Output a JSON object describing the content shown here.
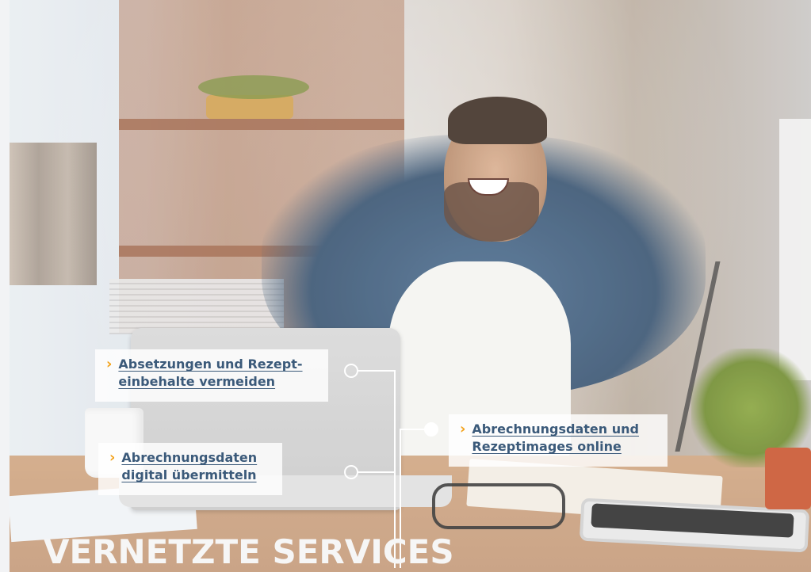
{
  "callouts": [
    {
      "text": "Absetzungen und Rezept-\neinbehalte vermeiden"
    },
    {
      "text": "Abrechnungsdaten und\nRezeptimages online"
    },
    {
      "text": "Abrechnungsdaten\ndigital übermitteln"
    }
  ],
  "title": "VERNETZTE SERVICES",
  "icons": {
    "callout_marker": "chevron-right-icon",
    "connector": "circle-node-icon"
  },
  "colors": {
    "accent": "#f3a21b",
    "link": "#3b5a7a",
    "title": "#f6f6f6"
  }
}
